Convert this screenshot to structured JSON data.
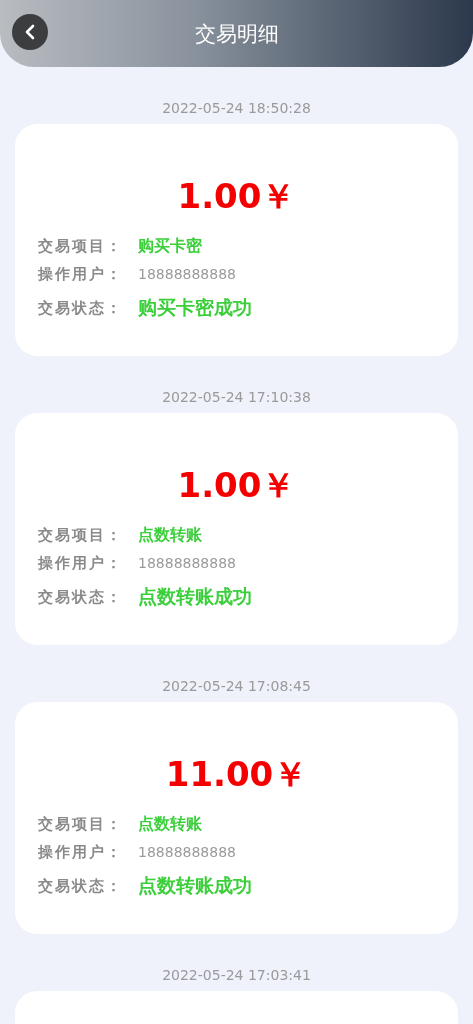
{
  "header": {
    "title": "交易明细"
  },
  "transactions": [
    {
      "time": "2022-05-24 18:50:28",
      "amount": "1.00￥",
      "item_label": "交易项目：",
      "item": "购买卡密",
      "user_label": "操作用户：",
      "user": "18888888888",
      "status_label": "交易状态：",
      "status": "购买卡密成功"
    },
    {
      "time": "2022-05-24 17:10:38",
      "amount": "1.00￥",
      "item_label": "交易项目：",
      "item": "点数转账",
      "user_label": "操作用户：",
      "user": "18888888888",
      "status_label": "交易状态：",
      "status": "点数转账成功"
    },
    {
      "time": "2022-05-24 17:08:45",
      "amount": "11.00￥",
      "item_label": "交易项目：",
      "item": "点数转账",
      "user_label": "操作用户：",
      "user": "18888888888",
      "status_label": "交易状态：",
      "status": "点数转账成功"
    },
    {
      "time": "2022-05-24 17:03:41"
    }
  ]
}
